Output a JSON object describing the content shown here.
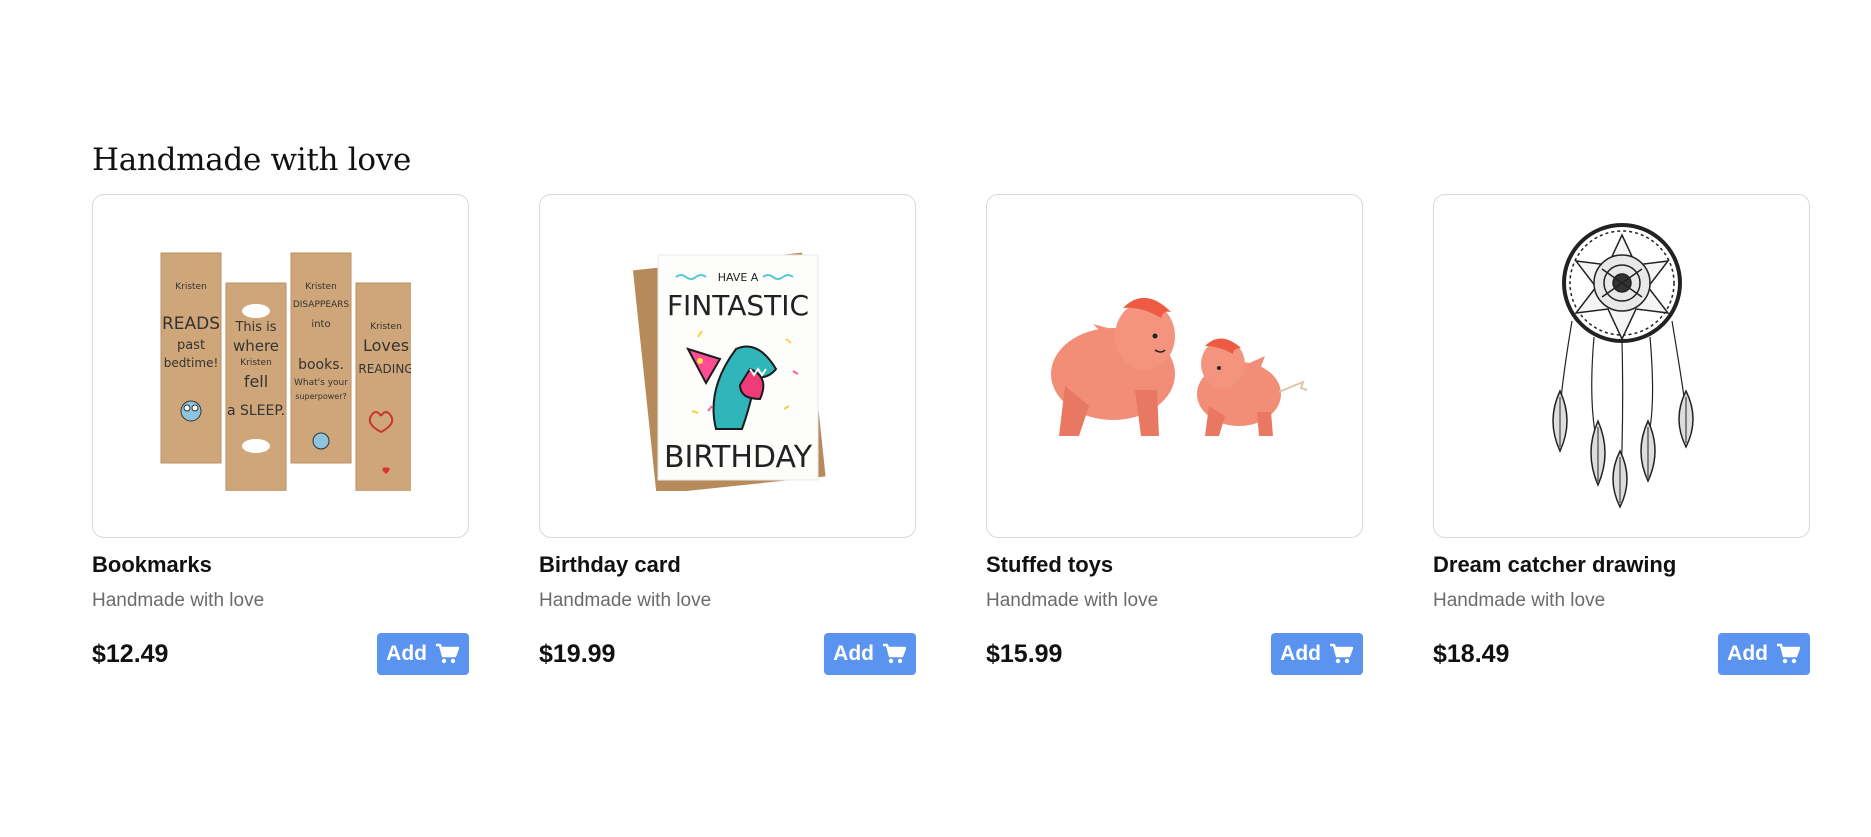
{
  "section": {
    "title": "Handmade with love"
  },
  "products": [
    {
      "name": "Bookmarks",
      "subtitle": "Handmade with love",
      "price": "$12.49",
      "button_label": "Add",
      "image_text": [
        "Kristen",
        "READS",
        "past",
        "bedtime!",
        "This is",
        "where",
        "Kristen",
        "fell",
        "a SLEEP.",
        "Kristen",
        "DISAPPEARS",
        "into",
        "books.",
        "What's your",
        "superpower?",
        "Kristen",
        "Loves",
        "READING"
      ]
    },
    {
      "name": "Birthday card",
      "subtitle": "Handmade with love",
      "price": "$19.99",
      "button_label": "Add",
      "image_text": [
        "HAVE A",
        "FINTASTIC",
        "BIRTHDAY"
      ]
    },
    {
      "name": "Stuffed toys",
      "subtitle": "Handmade with love",
      "price": "$15.99",
      "button_label": "Add"
    },
    {
      "name": "Dream catcher drawing",
      "subtitle": "Handmade with love",
      "price": "$18.49",
      "button_label": "Add"
    }
  ],
  "colors": {
    "accent": "#5b93f0",
    "card_border": "#d9d9d9",
    "muted_text": "#6b6b6b"
  },
  "icons": {
    "add_button": "shopping-cart-icon"
  }
}
